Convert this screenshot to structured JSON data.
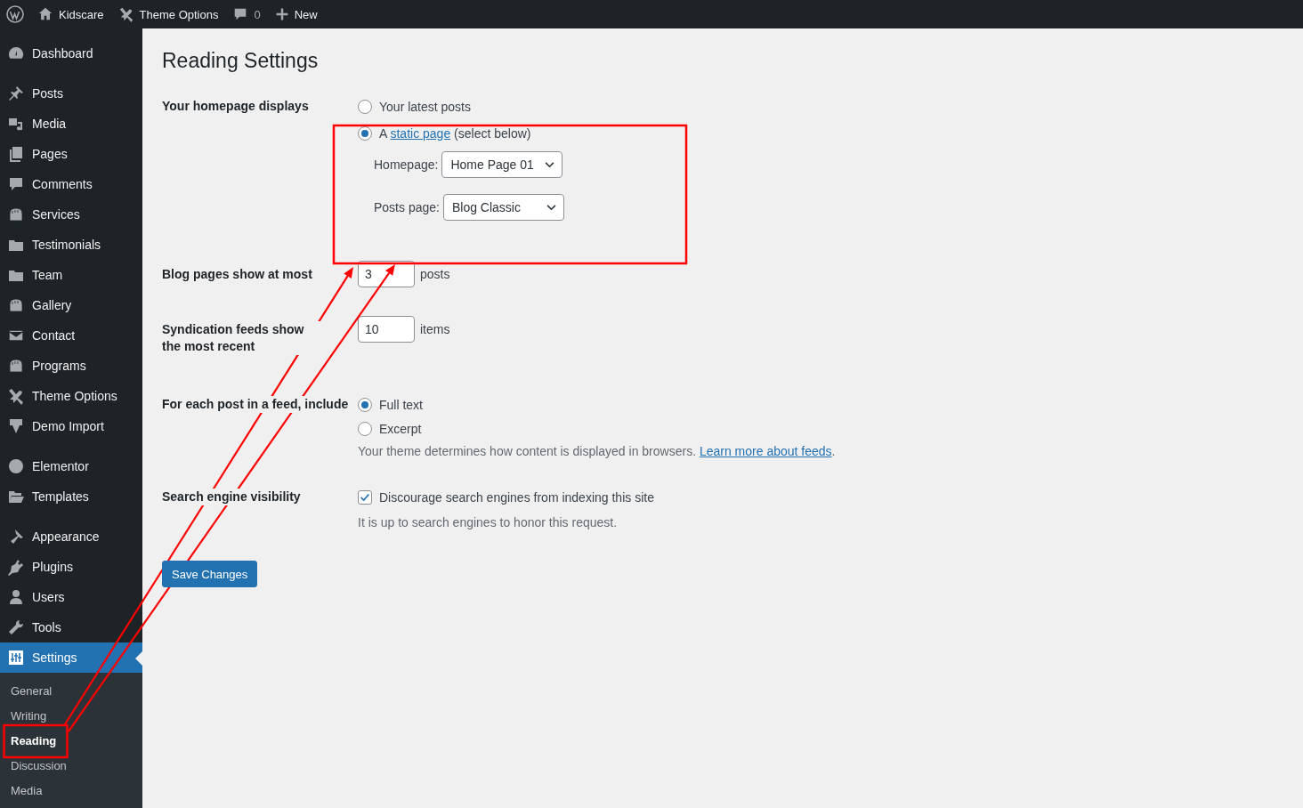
{
  "admin_bar": {
    "items": [
      {
        "kind": "site",
        "label": "Kidscare"
      },
      {
        "kind": "theme",
        "label": "Theme Options"
      },
      {
        "kind": "comments",
        "label": "0"
      },
      {
        "kind": "new",
        "label": "New"
      }
    ]
  },
  "sidebar": {
    "groups": [
      {
        "items": [
          {
            "label": "Dashboard",
            "selected": false
          }
        ]
      },
      {
        "items": [
          {
            "label": "Posts",
            "selected": false
          },
          {
            "label": "Media",
            "selected": false
          },
          {
            "label": "Pages",
            "selected": false
          },
          {
            "label": "Comments",
            "selected": false
          },
          {
            "label": "Services",
            "selected": false
          },
          {
            "label": "Testimonials",
            "selected": false
          },
          {
            "label": "Team",
            "selected": false
          },
          {
            "label": "Gallery",
            "selected": false
          },
          {
            "label": "Contact",
            "selected": false
          },
          {
            "label": "Programs",
            "selected": false
          },
          {
            "label": "Theme Options",
            "selected": false
          },
          {
            "label": "Demo Import",
            "selected": false
          }
        ]
      },
      {
        "items": [
          {
            "label": "Elementor",
            "selected": false
          },
          {
            "label": "Templates",
            "selected": false
          }
        ]
      },
      {
        "items": [
          {
            "label": "Appearance",
            "selected": false
          },
          {
            "label": "Plugins",
            "selected": false
          },
          {
            "label": "Users",
            "selected": false
          },
          {
            "label": "Tools",
            "selected": false
          },
          {
            "label": "Settings",
            "selected": true
          }
        ]
      }
    ],
    "submenu": [
      {
        "label": "General",
        "selected": false
      },
      {
        "label": "Writing",
        "selected": false
      },
      {
        "label": "Reading",
        "selected": true
      },
      {
        "label": "Discussion",
        "selected": false
      },
      {
        "label": "Media",
        "selected": false
      }
    ]
  },
  "page": {
    "title": "Reading Settings"
  },
  "homepage_displays": {
    "label": "Your homepage displays",
    "options": [
      {
        "kind": "plain",
        "text": "Your latest posts",
        "selected": false
      },
      {
        "kind": "link",
        "before": "A",
        "link": "static page",
        "after": "(select below)",
        "selected": true
      }
    ],
    "homepage": {
      "label": "Homepage:",
      "value": "Home Page 01"
    },
    "posts_page": {
      "label": "Posts page:",
      "value": "Blog Classic"
    }
  },
  "blog_pages": {
    "label": "Blog pages show at most",
    "value": "3",
    "unit": "posts"
  },
  "syndication": {
    "label": "Syndication feeds show the most recent",
    "value": "10",
    "unit": "items"
  },
  "feed_include": {
    "label": "For each post in a feed, include",
    "options": [
      {
        "text": "Full text",
        "selected": true
      },
      {
        "text": "Excerpt",
        "selected": false
      }
    ],
    "description": "Your theme determines how content is displayed in browsers.",
    "link": "Learn more about feeds",
    "after": "."
  },
  "search_visibility": {
    "label": "Search engine visibility",
    "checkbox": {
      "label": "Discourage search engines from indexing this site",
      "checked": true
    },
    "description": "It is up to search engines to honor this request."
  },
  "save_button": "Save Changes"
}
